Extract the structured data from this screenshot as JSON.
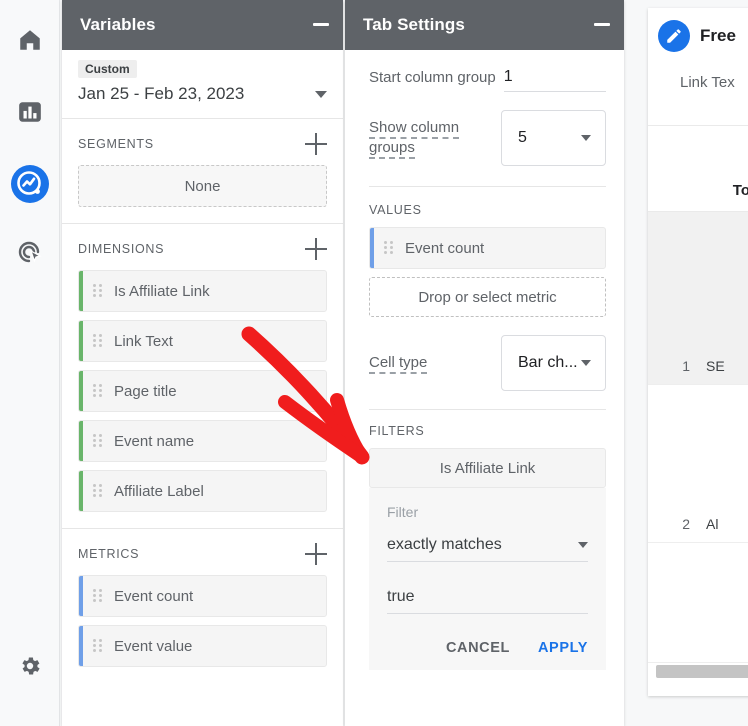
{
  "rail": {
    "items": [
      {
        "name": "home-icon",
        "label": "Home"
      },
      {
        "name": "reports-icon",
        "label": "Reports"
      },
      {
        "name": "explore-icon",
        "label": "Explore"
      },
      {
        "name": "advertising-icon",
        "label": "Advertising"
      }
    ],
    "settings_label": "Admin"
  },
  "variables": {
    "title": "Variables",
    "daterange": {
      "badge": "Custom",
      "value": "Jan 25 - Feb 23, 2023"
    },
    "segments": {
      "title": "SEGMENTS",
      "items": [
        {
          "label": "None"
        }
      ]
    },
    "dimensions": {
      "title": "DIMENSIONS",
      "items": [
        {
          "label": "Is Affiliate Link"
        },
        {
          "label": "Link Text"
        },
        {
          "label": "Page title"
        },
        {
          "label": "Event name"
        },
        {
          "label": "Affiliate Label"
        }
      ]
    },
    "metrics": {
      "title": "METRICS",
      "items": [
        {
          "label": "Event count"
        },
        {
          "label": "Event value"
        }
      ]
    }
  },
  "tab_settings": {
    "title": "Tab Settings",
    "start_column_group": {
      "label": "Start column group",
      "value": "1"
    },
    "show_column_groups": {
      "label": "Show column groups",
      "value": "5"
    },
    "values": {
      "title": "VALUES",
      "items": [
        {
          "label": "Event count"
        }
      ],
      "drop_placeholder": "Drop or select metric",
      "cell_type": {
        "label": "Cell type",
        "value": "Bar ch..."
      }
    },
    "filters": {
      "title": "FILTERS",
      "chip": "Is Affiliate Link",
      "popup": {
        "label": "Filter",
        "condition": "exactly matches",
        "value": "true",
        "cancel": "CANCEL",
        "apply": "APPLY"
      }
    }
  },
  "report": {
    "title": "Free ",
    "subtitle": "Link Tex",
    "column_header": "To",
    "rows": [
      {
        "num": "1",
        "value": "SE"
      },
      {
        "num": "2",
        "value": "Al"
      }
    ]
  },
  "colors": {
    "header_grey": "#5f6368",
    "accent_blue": "#1a73e8",
    "dimension_green": "#69b56a",
    "metric_blue": "#6f9fe8",
    "annotation_red": "#f01d1d"
  }
}
